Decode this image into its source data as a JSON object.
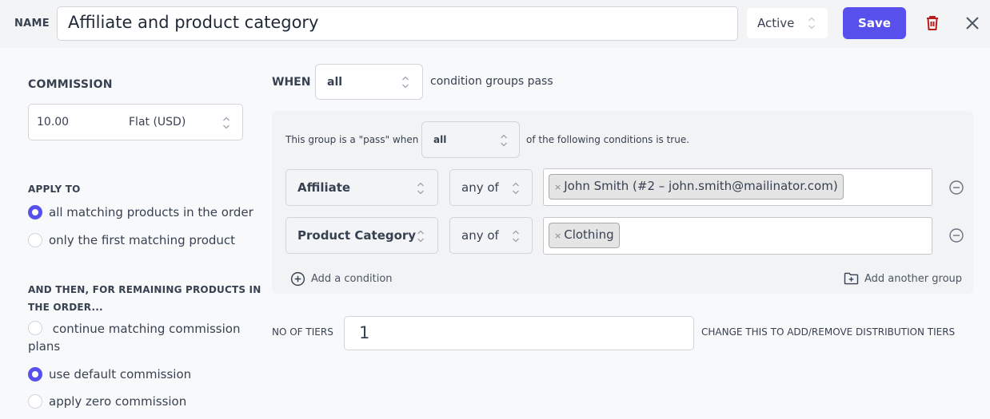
{
  "header": {
    "name_label": "NAME",
    "name_value": "Affiliate and product category",
    "status_value": "Active",
    "save_label": "Save",
    "delete_icon": "trash-icon",
    "close_icon": "close-icon"
  },
  "commission": {
    "label": "COMMISSION",
    "amount": "10.00",
    "type": "Flat (USD)"
  },
  "apply_to": {
    "label": "APPLY TO",
    "options": [
      {
        "label": "all matching products in the order",
        "selected": true
      },
      {
        "label": "only the first matching product",
        "selected": false
      }
    ]
  },
  "remaining": {
    "label_line1": "AND THEN, FOR REMAINING PRODUCTS IN",
    "label_line2": "THE ORDER...",
    "options": [
      {
        "label": "continue matching commission plans",
        "selected": false
      },
      {
        "label": "use default commission",
        "selected": true
      },
      {
        "label": "apply zero commission",
        "selected": false
      }
    ]
  },
  "when": {
    "label": "WHEN",
    "value": "all",
    "suffix": "condition groups pass"
  },
  "group": {
    "prefix": "This group is a \"pass\" when",
    "value": "all",
    "suffix": "of the following conditions is true.",
    "conditions": [
      {
        "field": "Affiliate",
        "operator": "any of",
        "tags": [
          "John Smith (#2 – john.smith@mailinator.com)"
        ]
      },
      {
        "field": "Product Category",
        "operator": "any of",
        "tags": [
          "Clothing"
        ]
      }
    ],
    "add_condition_label": "Add a condition",
    "add_group_label": "Add another group"
  },
  "tiers": {
    "label": "NO OF TIERS",
    "value": "1",
    "help": "CHANGE THIS TO ADD/REMOVE DISTRIBUTION TIERS"
  },
  "colors": {
    "accent": "#5850ec",
    "danger": "#b91c1c"
  }
}
